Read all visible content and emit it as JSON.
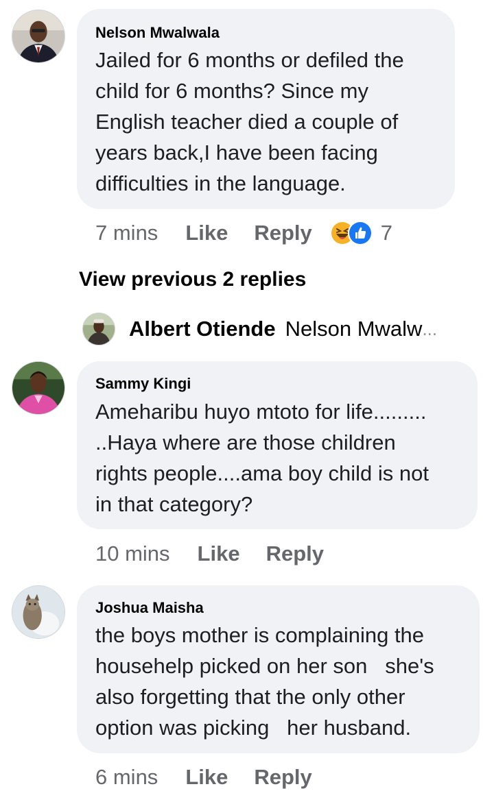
{
  "comments": [
    {
      "author": "Nelson Mwalwala",
      "lines": [
        "Jailed for 6 months or defiled the",
        "child for 6 months? Since my",
        "English teacher died a couple of",
        "years back,I have been facing",
        "difficulties in the language."
      ],
      "time": "7 mins",
      "like_label": "Like",
      "reply_label": "Reply",
      "reactions": {
        "icons": [
          "haha-icon",
          "like-icon"
        ],
        "count": "7"
      }
    },
    {
      "author": "Sammy Kingi",
      "lines": [
        "Ameharibu huyo mtoto for life.........",
        "..Haya where are those children",
        "rights people....ama boy child is not",
        "in that category?"
      ],
      "time": "10 mins",
      "like_label": "Like",
      "reply_label": "Reply"
    },
    {
      "author": "Joshua Maisha",
      "lines": [
        "the boys mother is complaining the",
        "househelp picked on her son   she's",
        "also forgetting that the only other",
        "option was picking   her husband."
      ],
      "time": "6 mins",
      "like_label": "Like",
      "reply_label": "Reply"
    }
  ],
  "view_previous_replies": "View previous 2 replies",
  "reply_preview": {
    "author": "Albert Otiende",
    "text": "Nelson Mwalw",
    "ellipsis": "..."
  },
  "colors": {
    "bubble": "#f0f2f5",
    "text": "#050505",
    "meta": "#65676b",
    "haha": "#f7b125",
    "like": "#1877f2"
  }
}
